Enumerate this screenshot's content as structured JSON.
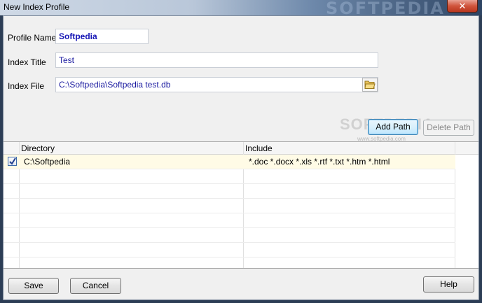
{
  "window": {
    "title": "New Index Profile",
    "title_watermark": "SOFTPEDIA",
    "close_glyph": "✕"
  },
  "form": {
    "profile_name_label": "Profile Name",
    "profile_name_value": "Softpedia",
    "index_title_label": "Index Title",
    "index_title_value": "Test",
    "index_file_label": "Index File",
    "index_file_value": "C:\\Softpedia\\Softpedia test.db",
    "browse_icon": "folder-open-icon"
  },
  "path_buttons": {
    "add_label": "Add Path",
    "delete_label": "Delete Path"
  },
  "watermark": {
    "text": "SOFTPEDIA",
    "url": "www.softpedia.com"
  },
  "grid": {
    "columns": [
      "Directory",
      "Include"
    ],
    "rows": [
      {
        "checked": true,
        "directory": "C:\\Softpedia",
        "include": "*.doc *.docx *.xls *.rtf *.txt *.htm *.html"
      }
    ]
  },
  "footer": {
    "save_label": "Save",
    "cancel_label": "Cancel",
    "help_label": "Help"
  },
  "colors": {
    "field_text": "#1a1aa0",
    "row_highlight": "#fffbe6",
    "focus_border": "#3c7fb1"
  }
}
